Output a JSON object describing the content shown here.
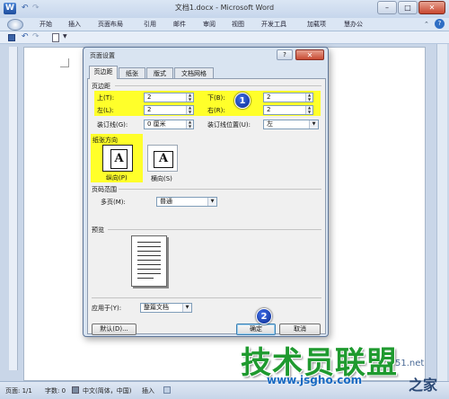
{
  "window": {
    "title": "文档1.docx - Microsoft Word",
    "minimize": "–",
    "maximize": "□",
    "close": "✕"
  },
  "ribbon": {
    "file_glyph": "W",
    "tabs": [
      "开始",
      "插入",
      "页面布局",
      "引用",
      "邮件",
      "审阅",
      "视图",
      "开发工具",
      "加载项",
      "慧办公"
    ],
    "help": "?"
  },
  "dialog": {
    "title": "页面设置",
    "help": "?",
    "close": "✕",
    "tabs": [
      "页边距",
      "纸张",
      "版式",
      "文档网格"
    ],
    "margins": {
      "section": "页边距",
      "top_label": "上(T):",
      "top_value": "2",
      "bottom_label": "下(B):",
      "bottom_value": "2",
      "left_label": "左(L):",
      "left_value": "2",
      "right_label": "右(R):",
      "right_value": "2",
      "gutter_label": "装订线(G):",
      "gutter_value": "0 厘米",
      "gutter_pos_label": "装订线位置(U):",
      "gutter_pos_value": "左"
    },
    "orientation": {
      "section": "纸张方向",
      "portrait": "纵向(P)",
      "landscape": "横向(S)",
      "glyph": "A"
    },
    "pages": {
      "section": "页码范围",
      "multi_label": "多页(M):",
      "multi_value": "普通"
    },
    "preview": {
      "section": "预览"
    },
    "apply": {
      "label": "应用于(Y):",
      "value": "整篇文档"
    },
    "buttons": {
      "default": "默认(D)...",
      "ok": "确定",
      "cancel": "取消"
    }
  },
  "badges": [
    "1",
    "2"
  ],
  "statusbar": {
    "page": "页面: 1/1",
    "words": "字数: 0",
    "lang": "中文(简体，中国)",
    "mode": "插入"
  },
  "watermark": {
    "text": "技术员联盟",
    "url": "www.jsgho.com",
    "num": "51.net",
    "home": "之家"
  },
  "colors": {
    "highlight": "#ffff2a",
    "badge": "#1e46c8",
    "watermark": "#1f9a2f"
  }
}
